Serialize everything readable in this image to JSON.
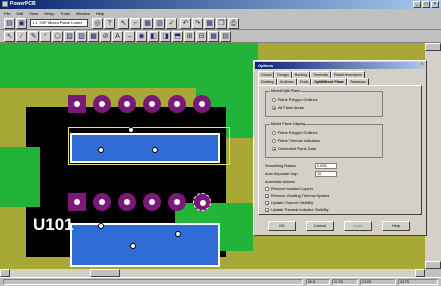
{
  "window": {
    "title": "PowerPCB"
  },
  "menu": [
    "File",
    "Edit",
    "View",
    "Setup",
    "Tools",
    "Window",
    "Help"
  ],
  "toolbar1": {
    "layer_select": "1-1 TOP Mixed Plane Lower"
  },
  "canvas": {
    "reference": "U101"
  },
  "dialog": {
    "title": "Options",
    "tabs_row1": [
      "Global",
      "Design",
      "Routing",
      "Thermals",
      "Pads/Dimensions"
    ],
    "tabs_row2": [
      "Drafting",
      "Gridlines",
      "Grids",
      "Split/Mixed Plane",
      "Teardrops"
    ],
    "group1": {
      "label": "Mixed/Split Plane",
      "options": [
        "Plane Polygon Outlines",
        "All Plane Areas"
      ],
      "selected": 1
    },
    "group2": {
      "label": "Mixed Plane Display",
      "options": [
        "Plane Polygon Outlines",
        "Plane Thermal Indicators",
        "Generated Plane Data"
      ],
      "selected": 2
    },
    "smoothing_radius_label": "Smoothing Radius",
    "smoothing_radius_value": "0.005",
    "auto_separate_label": "Auto Separate Gap",
    "auto_separate_value": "10",
    "automatic_label": "Automatic Actions",
    "checks": [
      {
        "label": "Remove Isolated Copper",
        "checked": false
      },
      {
        "label": "Remove Violating Thermal Spokes",
        "checked": true
      },
      {
        "label": "Update Channel Visibility",
        "checked": true
      },
      {
        "label": "Update Thermal Indicator Visibility",
        "checked": true
      }
    ],
    "buttons": {
      "ok": "OK",
      "cancel": "Cancel",
      "apply": "Apply",
      "help": "Help"
    }
  },
  "status": {
    "w": "W 8",
    "g": "G 25",
    "x": "2125",
    "y": "3475"
  }
}
